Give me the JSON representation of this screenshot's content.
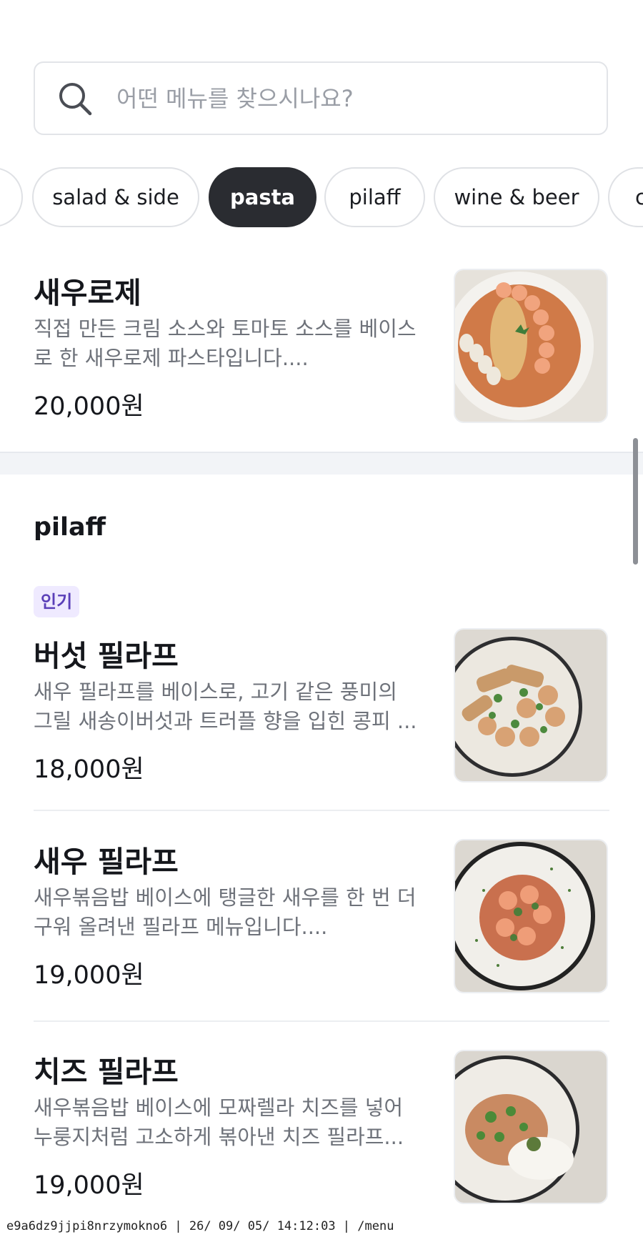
{
  "search": {
    "placeholder": "어떤 메뉴를 찾으시나요?"
  },
  "categories": [
    {
      "label": ""
    },
    {
      "label": "salad & side"
    },
    {
      "label": "pasta",
      "active": true
    },
    {
      "label": "pilaff"
    },
    {
      "label": "wine & beer"
    },
    {
      "label": "c"
    }
  ],
  "pasta_items": [
    {
      "name": "새우로제",
      "description": "직접 만든 크림 소스와 토마토 소스를 베이스로 한 새우로제 파스타입니다....",
      "price": "20,000원",
      "photo": "shrimp-rose-pasta"
    }
  ],
  "pilaff_section": {
    "title": "pilaff",
    "items": [
      {
        "badge": "인기",
        "name": "버섯 필라프",
        "description": "새우 필라프를 베이스로, 고기 같은 풍미의 그릴 새송이버섯과 트러플 향을 입힌 콩피 ...",
        "price": "18,000원",
        "photo": "mushroom-pilaff"
      },
      {
        "name": "새우 필라프",
        "description": "새우볶음밥 베이스에 탱글한 새우를 한 번 더 구워 올려낸 필라프 메뉴입니다....",
        "price": "19,000원",
        "photo": "shrimp-pilaff"
      },
      {
        "name": "치즈 필라프",
        "description": "새우볶음밥 베이스에 모짜렐라 치즈를 넣어 누룽지처럼 고소하게 볶아낸 치즈 필라프...",
        "price": "19,000원",
        "photo": "cheese-pilaff"
      }
    ]
  },
  "footer": {
    "url_text": "e9a6dz9jjpi8nrzymokno6 | 26/ 09/ 05/ 14:12:03 | /menu"
  },
  "colors": {
    "active_chip": "#2a2c31",
    "badge_bg": "#efeaff",
    "badge_text": "#5a3fb8",
    "desc_text": "#6e727a"
  }
}
